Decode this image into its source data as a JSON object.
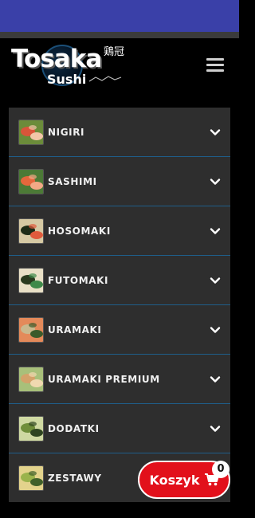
{
  "header": {
    "logo_title": "Tosaka",
    "logo_subtitle": "Sushi",
    "logo_kanji": "鶏冠",
    "menu_icon": "hamburger-icon"
  },
  "colors": {
    "status_bar": "#3a40a8",
    "panel_bg": "#2e2e2e",
    "divider": "#1f5e8a",
    "cart_red": "#e2101b"
  },
  "categories": [
    {
      "label": "NIGIRI",
      "thumb_colors": [
        "#d9553a",
        "#6b8c3a",
        "#f2c6a8"
      ]
    },
    {
      "label": "SASHIMI",
      "thumb_colors": [
        "#e4673c",
        "#4c7a36",
        "#f3a986"
      ]
    },
    {
      "label": "HOSOMAKI",
      "thumb_colors": [
        "#1d2b16",
        "#d6c9a3",
        "#e05b3c"
      ]
    },
    {
      "label": "FUTOMAKI",
      "thumb_colors": [
        "#2a3a1e",
        "#e9e0c6",
        "#3f8a4a"
      ]
    },
    {
      "label": "URAMAKI",
      "thumb_colors": [
        "#c9b98e",
        "#e48a5a",
        "#3b5a2a"
      ]
    },
    {
      "label": "URAMAKI PREMIUM",
      "thumb_colors": [
        "#d4a26a",
        "#a8c07a",
        "#f1d9b0"
      ]
    },
    {
      "label": "DODATKI",
      "thumb_colors": [
        "#6f8e3a",
        "#cfd9a2",
        "#2e4420"
      ]
    },
    {
      "label": "ZESTAWY",
      "thumb_colors": [
        "#9ab34c",
        "#e3d38c",
        "#40602a"
      ]
    }
  ],
  "cart": {
    "label": "Koszyk",
    "count": "0",
    "icon": "cart-icon"
  }
}
